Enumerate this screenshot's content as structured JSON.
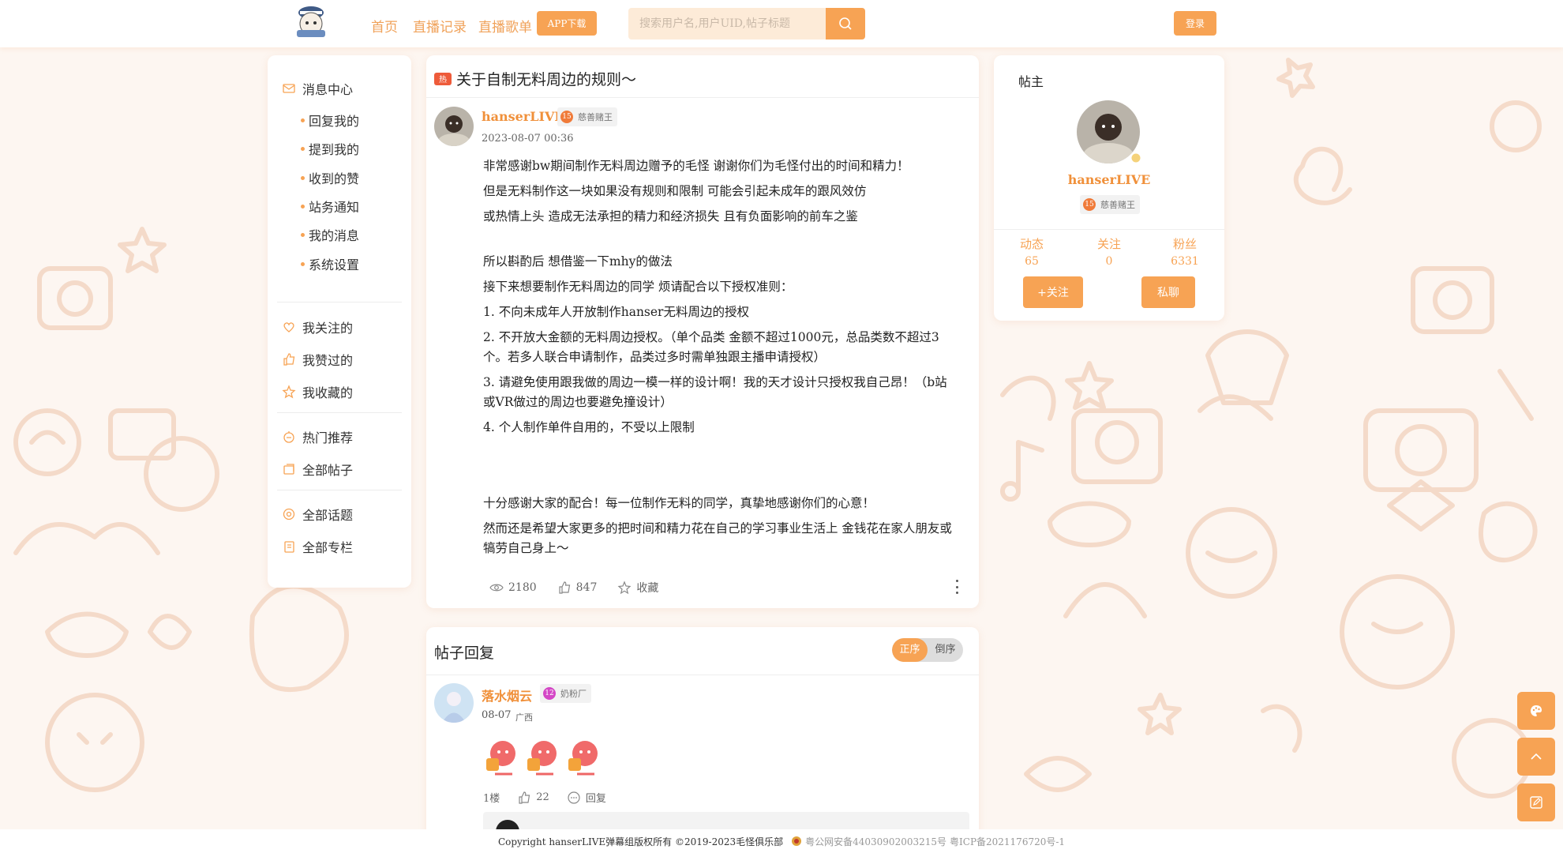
{
  "header": {
    "nav": [
      "首页",
      "直播记录",
      "直播歌单"
    ],
    "app_button": "APP下载",
    "search_placeholder": "搜索用户名,用户UID,帖子标题",
    "login_button": "登录"
  },
  "sidebar": {
    "message_center": "消息中心",
    "sub_items": [
      "回复我的",
      "提到我的",
      "收到的赞",
      "站务通知",
      "我的消息",
      "系统设置"
    ],
    "group2": [
      "我关注的",
      "我赞过的",
      "我收藏的"
    ],
    "group3": [
      "热门推荐",
      "全部帖子"
    ],
    "group4": [
      "全部话题",
      "全部专栏"
    ]
  },
  "post": {
    "badge": "热",
    "title": "关于自制无料周边的规则～",
    "author": "hanserLIVE",
    "level": "15",
    "level_title": "慈善赌王",
    "time": "2023-08-07 00:36",
    "paragraphs": [
      "非常感谢bw期间制作无料周边赠予的毛怪 谢谢你们为毛怪付出的时间和精力！",
      "但是无料制作这一块如果没有规则和限制 可能会引起未成年的跟风效仿",
      "或热情上头 造成无法承担的精力和经济损失 且有负面影响的前车之鉴",
      "所以斟酌后 想借鉴一下mhy的做法",
      "接下来想要制作无料周边的同学 烦请配合以下授权准则：",
      "1. 不向未成年人开放制作hanser无料周边的授权",
      "2. 不开放大金额的无料周边授权。（单个品类 金额不超过1000元，总品类数不超过3个。若多人联合申请制作，品类过多时需单独跟主播申请授权）",
      "3. 请避免使用跟我做的周边一模一样的设计啊！我的天才设计只授权我自己昂！（b站或VR做过的周边也要避免撞设计）",
      "4. 个人制作单件自用的，不受以上限制",
      "十分感谢大家的配合！每一位制作无料的同学，真挚地感谢你们的心意！",
      "然而还是希望大家更多的把时间和精力花在自己的学习事业生活上 金钱花在家人朋友或犒劳自己身上～"
    ],
    "views": "2180",
    "likes": "847",
    "favorite_label": "收藏"
  },
  "replies": {
    "title": "帖子回复",
    "sort_on": "正序",
    "sort_off": "倒序",
    "first": {
      "name": "落水烟云",
      "level": "12",
      "level_title": "奶粉厂",
      "date": "08-07",
      "location": "广西",
      "floor": "1楼",
      "likes": "22",
      "reply_label": "回复"
    }
  },
  "author_card": {
    "label": "帖主",
    "name": "hanserLIVE",
    "level": "15",
    "level_title": "慈善赌王",
    "stats": [
      {
        "k": "动态",
        "v": "65"
      },
      {
        "k": "关注",
        "v": "0"
      },
      {
        "k": "粉丝",
        "v": "6331"
      }
    ],
    "follow_button": "+关注",
    "message_button": "私聊"
  },
  "footer": {
    "copyright": "Copyright hanserLIVE弹幕组版权所有 ©2019-2023毛怪俱乐部",
    "police": "粤公网安备44030902003215号",
    "icp": "粤ICP备2021176720号-1"
  },
  "colors": {
    "accent": "#f7a354",
    "name": "#f0903a",
    "hot": "#ee5b3a",
    "background": "#fdf6f1"
  }
}
